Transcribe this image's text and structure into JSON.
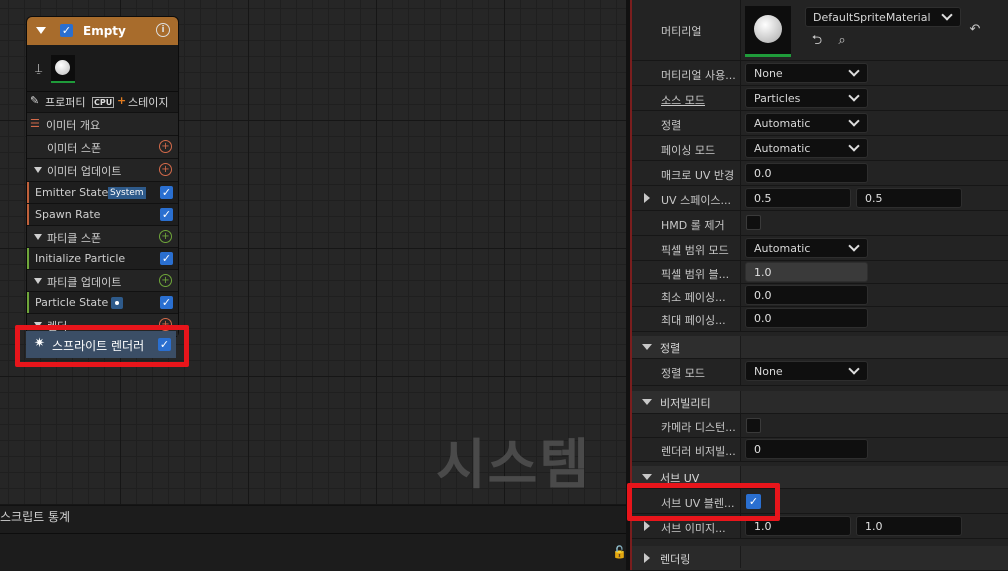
{
  "graph": {
    "watermark": "시스템",
    "bottom_title": "스크립트 통계"
  },
  "emitter": {
    "title": "Empty",
    "toolbar": {
      "properties": "프로퍼티",
      "cpu_badge": "CPU",
      "stage": "스테이지"
    },
    "rows": {
      "overview": "이미터 개요",
      "spawn": "이미터 스폰",
      "update": "이미터 업데이트",
      "emitter_state": "Emitter State",
      "system_badge": "System",
      "spawn_rate": "Spawn Rate",
      "particle_spawn": "파티클 스폰",
      "initialize_particle": "Initialize Particle",
      "particle_update": "파티클 업데이트",
      "particle_state": "Particle State",
      "render": "렌더",
      "sprite_renderer": "스프라이트 렌더러"
    }
  },
  "details": {
    "material_label": "머티리얼",
    "material_value": "DefaultSpriteMaterial",
    "material_usage": {
      "label": "머티리얼 사용...",
      "value": "None"
    },
    "source_mode": {
      "label": "소스 모드",
      "value": "Particles"
    },
    "alignment": {
      "label": "정렬",
      "value": "Automatic"
    },
    "facing_mode": {
      "label": "페이싱 모드",
      "value": "Automatic"
    },
    "macro_uv": {
      "label": "매크로 UV 반경",
      "value": "0.0"
    },
    "uv_space": {
      "label": "UV 스페이스...",
      "x": "0.5",
      "y": "0.5"
    },
    "hmd_remove": {
      "label": "HMD 롤 제거"
    },
    "pixel_cov_mode": {
      "label": "픽셀 범위 모드",
      "value": "Automatic"
    },
    "pixel_cov_blend": {
      "label": "픽셀 범위 블...",
      "value": "1.0"
    },
    "min_facing": {
      "label": "최소 페이싱...",
      "value": "0.0"
    },
    "max_facing": {
      "label": "최대 페이싱...",
      "value": "0.0"
    },
    "sec_sort": "정렬",
    "sort_mode": {
      "label": "정렬 모드",
      "value": "None"
    },
    "sec_visibility": "비저빌리티",
    "camera_dist": {
      "label": "카메라 디스턴..."
    },
    "renderer_vis": {
      "label": "렌더러 비저빌...",
      "value": "0"
    },
    "sec_subuv": "서브 UV",
    "subuv_blend": {
      "label": "서브 UV 블렌..."
    },
    "subimage": {
      "label": "서브 이미지...",
      "x": "1.0",
      "y": "1.0"
    },
    "sec_rendering": "렌더링"
  },
  "colors": {
    "highlight": "#e8151b",
    "checkbox_blue": "#2a6fd0",
    "emitter_header": "#a86c2c"
  }
}
